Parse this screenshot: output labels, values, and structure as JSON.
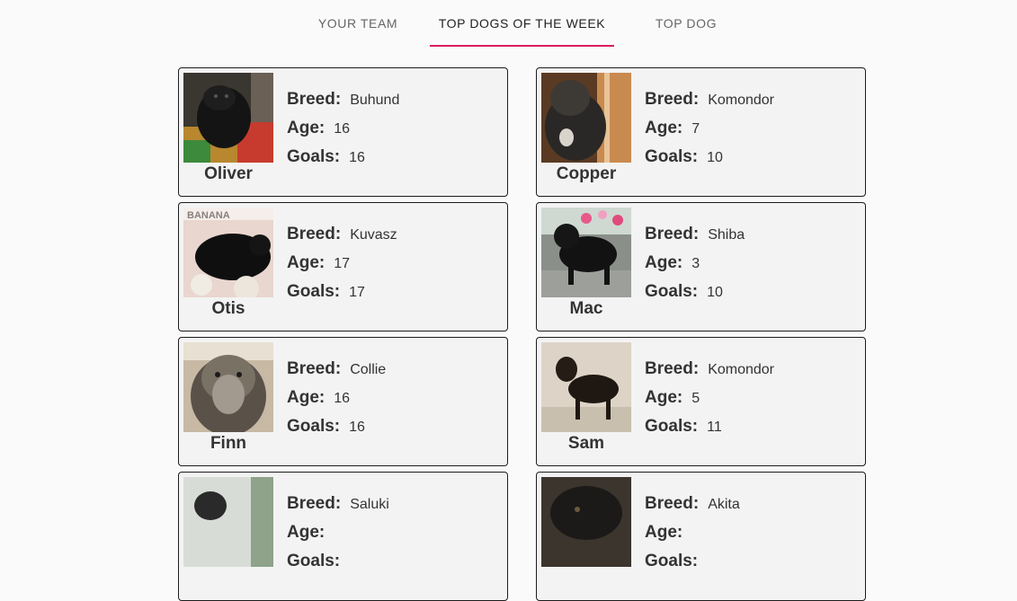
{
  "tabs": [
    {
      "label": "YOUR TEAM",
      "active": false
    },
    {
      "label": "TOP DOGS OF THE WEEK",
      "active": true
    },
    {
      "label": "TOP DOG",
      "active": false
    }
  ],
  "labels": {
    "breed": "Breed:",
    "age": "Age:",
    "goals": "Goals:"
  },
  "accent_color": "#d81b60",
  "dogs": [
    {
      "name": "Oliver",
      "breed": "Buhund",
      "age": "16",
      "goals": "16"
    },
    {
      "name": "Copper",
      "breed": "Komondor",
      "age": "7",
      "goals": "10"
    },
    {
      "name": "Otis",
      "breed": "Kuvasz",
      "age": "17",
      "goals": "17"
    },
    {
      "name": "Mac",
      "breed": "Shiba",
      "age": "3",
      "goals": "10"
    },
    {
      "name": "Finn",
      "breed": "Collie",
      "age": "16",
      "goals": "16"
    },
    {
      "name": "Sam",
      "breed": "Komondor",
      "age": "5",
      "goals": "11"
    },
    {
      "name": "",
      "breed": "Saluki",
      "age": "",
      "goals": ""
    },
    {
      "name": "",
      "breed": "Akita",
      "age": "",
      "goals": ""
    }
  ]
}
